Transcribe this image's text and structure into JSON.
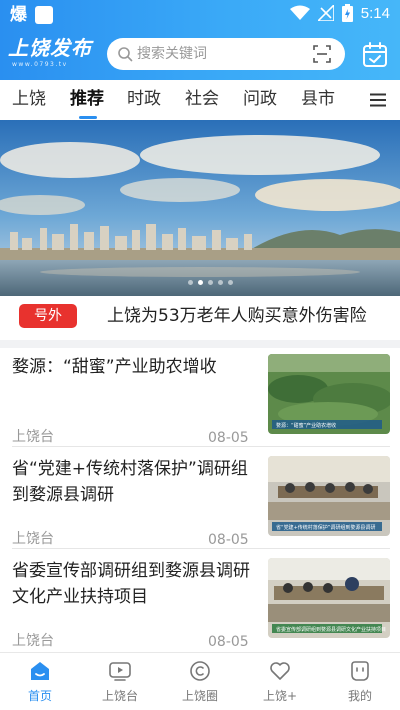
{
  "status_bar": {
    "app_glyph": "爆",
    "time": "5:14",
    "icons": [
      "wifi-icon",
      "signal-icon",
      "battery-icon"
    ]
  },
  "header": {
    "logo_text": "上饶发布",
    "logo_subtext": "www.0793.tv",
    "search_placeholder": "搜索关键词",
    "icons": [
      "search-icon",
      "scan-icon",
      "calendar-icon"
    ]
  },
  "tabs": {
    "items": [
      {
        "label": "上饶",
        "active": false
      },
      {
        "label": "推荐",
        "active": true
      },
      {
        "label": "时政",
        "active": false
      },
      {
        "label": "社会",
        "active": false
      },
      {
        "label": "问政",
        "active": false
      },
      {
        "label": "县市",
        "active": false
      }
    ],
    "menu_icon": "menu-icon"
  },
  "banner": {
    "slides": 5,
    "active_slide": 2
  },
  "headline": {
    "badge": "号外",
    "title": "上饶为53万老年人购买意外伤害险"
  },
  "news": [
    {
      "title": "婺源：“甜蜜”产业助农增收",
      "source": "上饶台",
      "date": "08-05",
      "thumb_caption": "婺源：“甜蜜”产业助农增收"
    },
    {
      "title": "省“党建+传统村落保护”调研组到婺源县调研",
      "source": "上饶台",
      "date": "08-05",
      "thumb_caption": "省“党建+传统村落保护”调研组到婺源县调研"
    },
    {
      "title": "省委宣传部调研组到婺源县调研文化产业扶持项目",
      "source": "上饶台",
      "date": "08-05",
      "thumb_caption": "省委宣传部调研组到婺源县调研文化产业扶持项目"
    }
  ],
  "bottom_nav": {
    "items": [
      {
        "label": "首页",
        "icon": "home-icon",
        "active": true
      },
      {
        "label": "上饶台",
        "icon": "tv-icon",
        "active": false
      },
      {
        "label": "上饶圈",
        "icon": "circle-icon",
        "active": false
      },
      {
        "label": "上饶+",
        "icon": "heart-icon",
        "active": false
      },
      {
        "label": "我的",
        "icon": "profile-icon",
        "active": false
      }
    ]
  },
  "colors": {
    "brand_blue": "#2a8ff0",
    "badge_red": "#e8322e",
    "muted_text": "#999999"
  }
}
